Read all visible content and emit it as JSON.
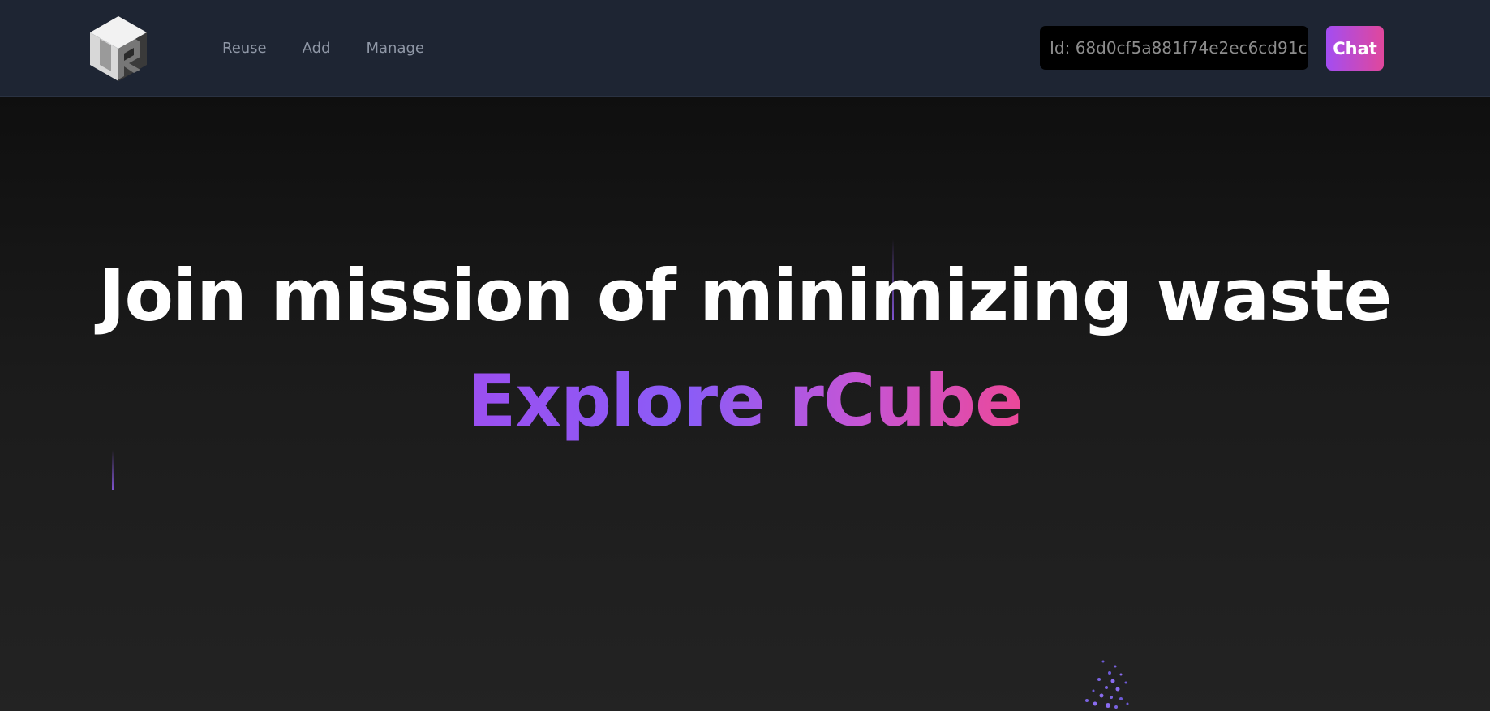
{
  "navbar": {
    "links": [
      {
        "label": "Reuse"
      },
      {
        "label": "Add"
      },
      {
        "label": "Manage"
      }
    ],
    "id_text": "Id: 68d0cf5a881f74e2ec6cd91c",
    "chat_label": "Chat",
    "logo_icon": "rcube-logo-icon"
  },
  "hero": {
    "headline": "Join mission of minimizing waste",
    "subhead": "Explore rCube"
  },
  "colors": {
    "nav_bg": "#1e2533",
    "page_bg": "#121212",
    "accent_start": "#a34df2",
    "accent_end": "#e0479c"
  }
}
